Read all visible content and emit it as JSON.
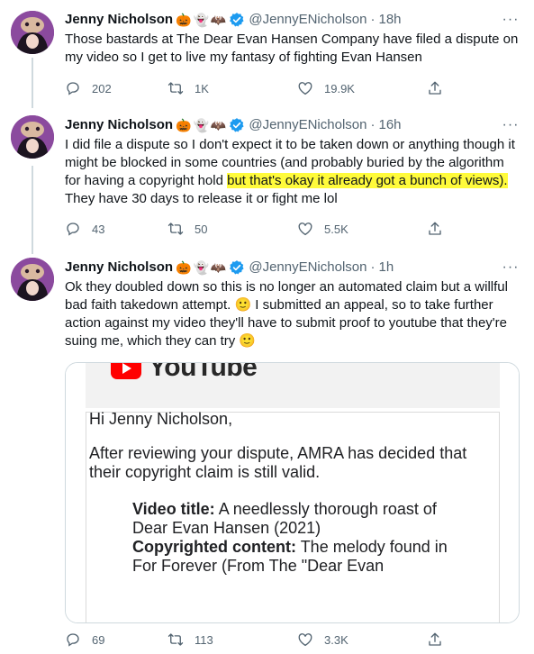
{
  "tweets": [
    {
      "name": "Jenny Nicholson",
      "emojis": [
        "🎃",
        "👻",
        "🦇"
      ],
      "handle": "@JennyENicholson",
      "time": "18h",
      "text": "Those bastards at The Dear Evan Hansen Company have filed a dispute on my video so I get to live my fantasy of fighting Evan Hansen",
      "replies": "202",
      "retweets": "1K",
      "likes": "19.9K"
    },
    {
      "name": "Jenny Nicholson",
      "emojis": [
        "🎃",
        "👻",
        "🦇"
      ],
      "handle": "@JennyENicholson",
      "time": "16h",
      "text_before": "I did file a dispute so I don't expect it to be taken down or anything though it might be blocked in some countries (and probably buried by the algorithm for having a copyright hold ",
      "text_highlight": "but that's okay it already got a bunch of views).",
      "text_after": " They have 30 days to release it or fight me lol",
      "replies": "43",
      "retweets": "50",
      "likes": "5.5K"
    },
    {
      "name": "Jenny Nicholson",
      "emojis": [
        "🎃",
        "👻",
        "🦇"
      ],
      "handle": "@JennyENicholson",
      "time": "1h",
      "text_part1": "Ok they doubled down so this is no longer an automated claim but a willful bad faith takedown attempt. ",
      "emoji1": "🙂",
      "text_part2": " I submitted an appeal, so to take further action against my video they'll have to submit proof to youtube that they're suing me, which they can try ",
      "emoji2": "🙂",
      "replies": "69",
      "retweets": "113",
      "likes": "3.3K"
    }
  ],
  "media": {
    "logo_text": "YouTube",
    "greeting": "Hi Jenny Nicholson,",
    "paragraph": "After reviewing your dispute, AMRA has decided that their copyright claim is still valid.",
    "video_title_label": "Video title:",
    "video_title": "A needlessly thorough roast of Dear Evan Hansen (2021)",
    "copyrighted_label": "Copyrighted content:",
    "copyrighted_value": "The melody found in For Forever (From The \"Dear Evan"
  },
  "icons": {
    "reply": "speech-bubble-icon",
    "retweet": "retweet-arrows-icon",
    "like": "heart-icon",
    "share": "share-upload-icon",
    "more": "more-dots-icon",
    "verified": "verified-badge-icon"
  },
  "colors": {
    "text": "#0f1419",
    "secondary": "#536471",
    "verified": "#1d9bf0",
    "highlight": "#fffb3b",
    "youtube_red": "#ff0000"
  }
}
